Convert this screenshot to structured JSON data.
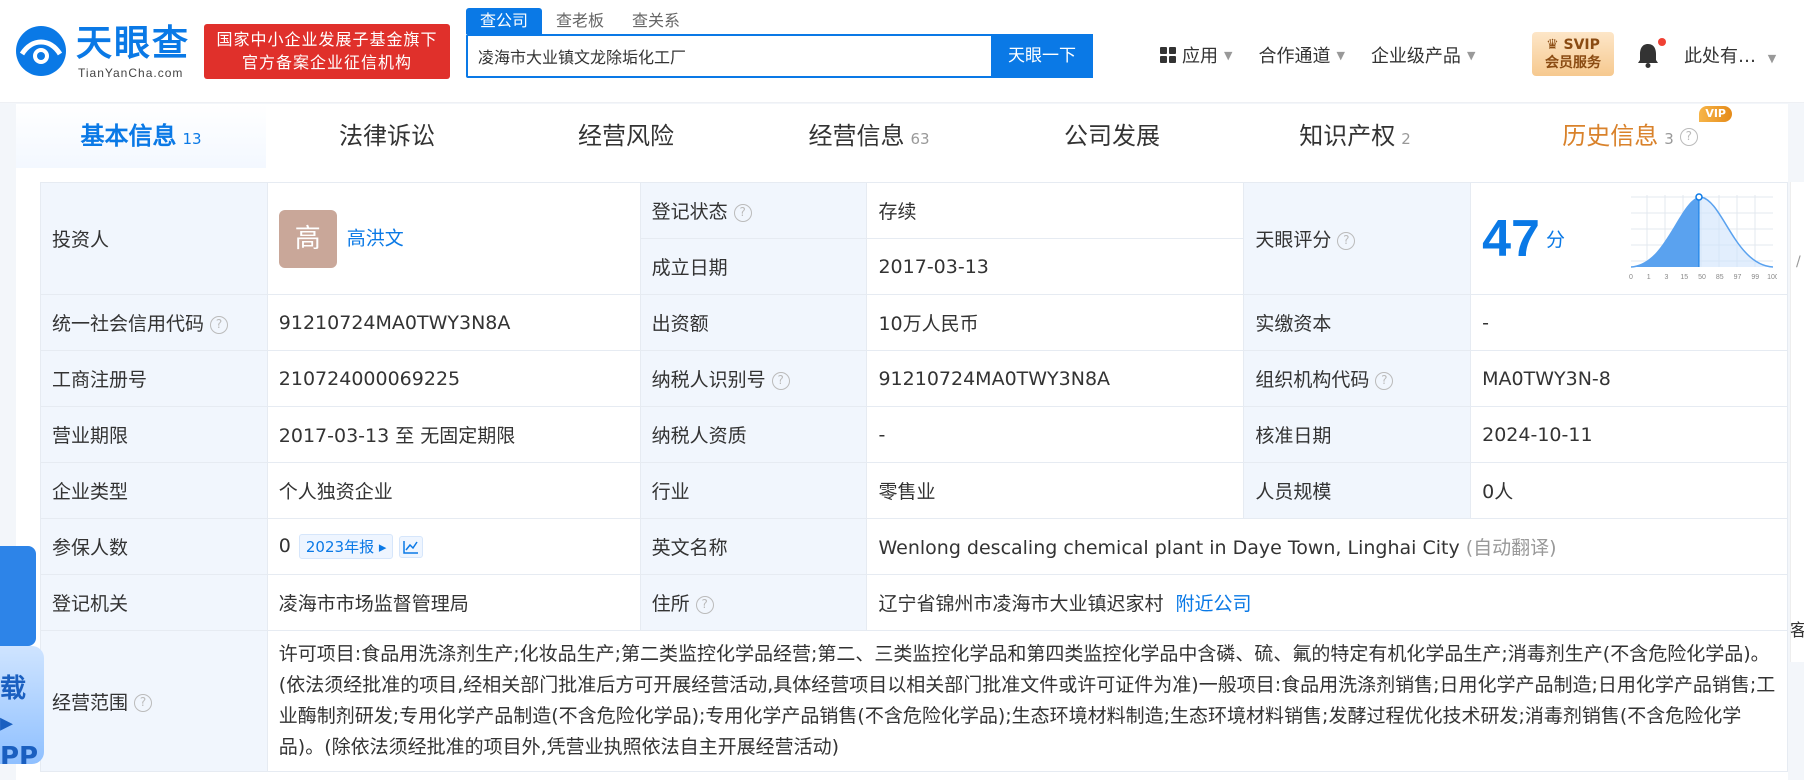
{
  "header": {
    "logo_text": "天眼查",
    "logo_sub": "TianYanCha.com",
    "badge_line1": "国家中小企业发展子基金旗下",
    "badge_line2": "官方备案企业征信机构",
    "search_tabs": [
      "查公司",
      "查老板",
      "查关系"
    ],
    "search_value": "凌海市大业镇文龙除垢化工厂",
    "search_button": "天眼一下",
    "nav": [
      "应用",
      "合作通道",
      "企业级产品"
    ],
    "svip_line1": "SVIP",
    "svip_line2": "会员服务",
    "user": "此处有…"
  },
  "tabs": [
    {
      "label": "基本信息",
      "count": "13"
    },
    {
      "label": "法律诉讼",
      "count": ""
    },
    {
      "label": "经营风险",
      "count": ""
    },
    {
      "label": "经营信息",
      "count": "63"
    },
    {
      "label": "公司发展",
      "count": ""
    },
    {
      "label": "知识产权",
      "count": "2"
    },
    {
      "label": "历史信息",
      "count": "3",
      "vip": "VIP"
    }
  ],
  "info": {
    "investor_label": "投资人",
    "investor_avatar": "高",
    "investor_name": "高洪文",
    "reg_status_label": "登记状态",
    "reg_status": "存续",
    "found_date_label": "成立日期",
    "found_date": "2017-03-13",
    "score_label": "天眼评分",
    "score": "47",
    "score_unit": "分",
    "score_axis": [
      "0",
      "1",
      "3",
      "15",
      "50",
      "85",
      "97",
      "99",
      "100"
    ],
    "credit_code_label": "统一社会信用代码",
    "credit_code": "91210724MA0TWY3N8A",
    "capital_label": "出资额",
    "capital": "10万人民币",
    "paid_label": "实缴资本",
    "paid": "-",
    "biz_reg_label": "工商注册号",
    "biz_reg": "210724000069225",
    "taxpayer_id_label": "纳税人识别号",
    "taxpayer_id": "91210724MA0TWY3N8A",
    "org_code_label": "组织机构代码",
    "org_code": "MA0TWY3N-8",
    "term_label": "营业期限",
    "term": "2017-03-13 至 无固定期限",
    "taxpayer_q_label": "纳税人资质",
    "taxpayer_q": "-",
    "approve_label": "核准日期",
    "approve": "2024-10-11",
    "type_label": "企业类型",
    "type": "个人独资企业",
    "industry_label": "行业",
    "industry": "零售业",
    "staff_label": "人员规模",
    "staff": "0人",
    "insured_label": "参保人数",
    "insured": "0",
    "insured_report": "2023年报",
    "en_name_label": "英文名称",
    "en_name": "Wenlong descaling chemical plant in Daye Town, Linghai City",
    "en_name_note": "(自动翻译)",
    "authority_label": "登记机关",
    "authority": "凌海市市场监督管理局",
    "address_label": "住所",
    "address": "辽宁省锦州市凌海市大业镇迟家村",
    "nearby": "附近公司",
    "scope_label": "经营范围",
    "scope": "许可项目:食品用洗涤剂生产;化妆品生产;第二类监控化学品经营;第二、三类监控化学品和第四类监控化学品中含磷、硫、氟的特定有机化学品生产;消毒剂生产(不含危险化学品)。(依法须经批准的项目,经相关部门批准后方可开展经营活动,具体经营项目以相关部门批准文件或许可证件为准)一般项目:食品用洗涤剂销售;日用化学产品制造;日用化学产品销售;工业酶制剂研发;专用化学产品制造(不含危险化学品);专用化学产品销售(不含危险化学品);生态环境材料制造;生态环境材料销售;发酵过程优化技术研发;消毒剂销售(不含危险化学品)。(除依法须经批准的项目外,凭营业执照依法自主开展经营活动)"
  },
  "floating": {
    "left_text_1": "载 ▸",
    "left_text_2": "PP",
    "right_char": "客",
    "right_char_top": "/"
  },
  "colors": {
    "brand": "#0a79e6",
    "badge_red": "#e0302b",
    "status_green": "#1aa35a",
    "vip_orange": "#d9822b"
  }
}
